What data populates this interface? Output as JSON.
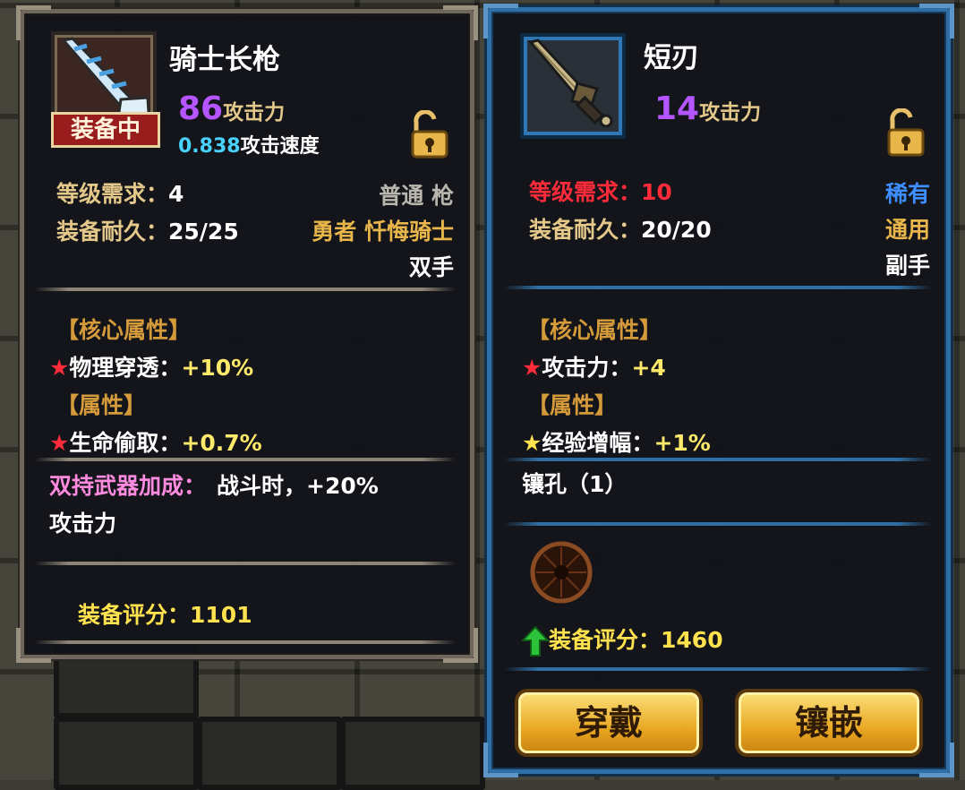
{
  "left_item": {
    "name": "骑士长枪",
    "equipped_badge": "装备中",
    "attack_value": "86",
    "attack_label": "攻击力",
    "speed_value": "0.838",
    "speed_label": "攻击速度",
    "level_req_label": "等级需求：",
    "level_req_value": "4",
    "rarity_type": "普通 枪",
    "durability_label": "装备耐久：",
    "durability_value": "25/25",
    "class_req": "勇者 忏悔骑士",
    "hands": "双手",
    "core_header": "【核心属性】",
    "core_stat_label": "物理穿透：",
    "core_stat_value": "+10%",
    "attr_header": "【属性】",
    "attr_stat_label": "生命偷取：",
    "attr_stat_value": "+0.7%",
    "dual_bonus_label": "双持武器加成：",
    "dual_bonus_value": "战斗时，+20%",
    "dual_bonus_line2": "攻击力",
    "score_label": "装备评分：",
    "score_value": "1101",
    "star": "★"
  },
  "right_item": {
    "name": "短刃",
    "attack_value": "14",
    "attack_label": "攻击力",
    "level_req_label": "等级需求：",
    "level_req_value": "10",
    "rarity": "稀有",
    "durability_label": "装备耐久：",
    "durability_value": "20/20",
    "usage": "通用",
    "hands": "副手",
    "core_header": "【核心属性】",
    "core_stat_label": "攻击力：",
    "core_stat_value": "+4",
    "attr_header": "【属性】",
    "attr_stat_label": "经验增幅：",
    "attr_stat_value": "+1%",
    "socket_text": "镶孔（1）",
    "score_label": "装备评分：",
    "score_value": "1460",
    "star": "★",
    "buttons": {
      "wear": "穿戴",
      "inlay": "镶嵌"
    }
  },
  "colors": {
    "attack_purple": "#b455ff",
    "speed_cyan": "#47d2ff",
    "requirement_red": "#ff2b3a",
    "rarity_blue": "#3d8fff",
    "score_yellow": "#ffe24d",
    "button_gold": "#e9a724"
  }
}
